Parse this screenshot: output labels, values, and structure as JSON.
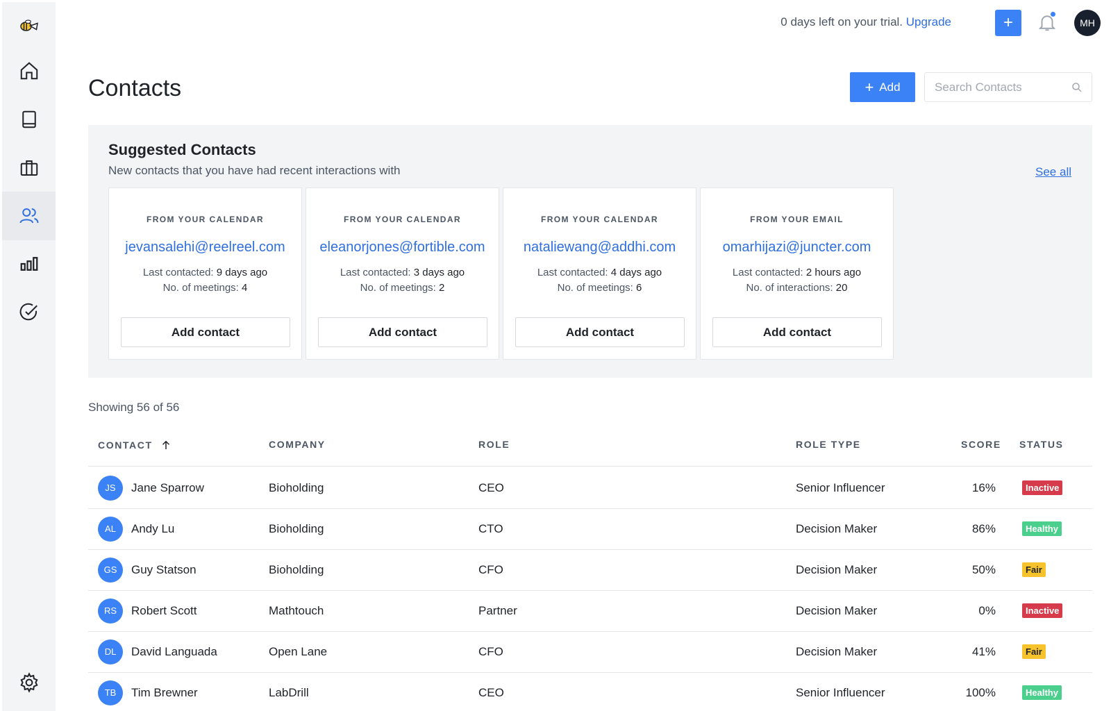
{
  "topbar": {
    "trial_text": "0 days left on your trial.",
    "upgrade_label": "Upgrade",
    "plus_label": "+",
    "avatar_initials": "MH"
  },
  "page": {
    "title": "Contacts",
    "add_label": "Add",
    "search_placeholder": "Search Contacts"
  },
  "suggested": {
    "title": "Suggested Contacts",
    "subtitle": "New contacts that you have had recent interactions with",
    "see_all": "See all",
    "cards": [
      {
        "source": "FROM YOUR CALENDAR",
        "email": "jevansalehi@reelreel.com",
        "contacted_label": "Last contacted:",
        "contacted_value": "9 days ago",
        "count_label": "No. of meetings:",
        "count_value": "4",
        "button": "Add contact"
      },
      {
        "source": "FROM YOUR CALENDAR",
        "email": "eleanorjones@fortible.com",
        "contacted_label": "Last contacted:",
        "contacted_value": "3 days ago",
        "count_label": "No. of meetings:",
        "count_value": "2",
        "button": "Add contact"
      },
      {
        "source": "FROM YOUR CALENDAR",
        "email": "nataliewang@addhi.com",
        "contacted_label": "Last contacted:",
        "contacted_value": "4 days ago",
        "count_label": "No. of meetings:",
        "count_value": "6",
        "button": "Add contact"
      },
      {
        "source": "FROM YOUR EMAIL",
        "email": "omarhijazi@juncter.com",
        "contacted_label": "Last contacted:",
        "contacted_value": "2 hours ago",
        "count_label": "No. of interactions:",
        "count_value": "20",
        "button": "Add contact"
      }
    ]
  },
  "table": {
    "showing": "Showing 56 of 56",
    "headers": {
      "contact": "CONTACT",
      "company": "COMPANY",
      "role": "ROLE",
      "role_type": "ROLE TYPE",
      "score": "SCORE",
      "status": "STATUS"
    },
    "rows": [
      {
        "initials": "JS",
        "name": "Jane Sparrow",
        "company": "Bioholding",
        "role": "CEO",
        "role_type": "Senior Influencer",
        "score": "16%",
        "status": "Inactive"
      },
      {
        "initials": "AL",
        "name": "Andy Lu",
        "company": "Bioholding",
        "role": "CTO",
        "role_type": "Decision Maker",
        "score": "86%",
        "status": "Healthy"
      },
      {
        "initials": "GS",
        "name": "Guy Statson",
        "company": "Bioholding",
        "role": "CFO",
        "role_type": "Decision Maker",
        "score": "50%",
        "status": "Fair"
      },
      {
        "initials": "RS",
        "name": "Robert Scott",
        "company": "Mathtouch",
        "role": "Partner",
        "role_type": "Decision Maker",
        "score": "0%",
        "status": "Inactive"
      },
      {
        "initials": "DL",
        "name": "David Languada",
        "company": "Open Lane",
        "role": "CFO",
        "role_type": "Decision Maker",
        "score": "41%",
        "status": "Fair"
      },
      {
        "initials": "TB",
        "name": "Tim Brewner",
        "company": "LabDrill",
        "role": "CEO",
        "role_type": "Senior Influencer",
        "score": "100%",
        "status": "Healthy"
      }
    ]
  },
  "colors": {
    "accent": "#3b82f6",
    "link": "#2f6fdf",
    "inactive": "#d63b4b",
    "healthy": "#4bcf8c",
    "fair": "#f6c32c"
  },
  "icons": {
    "sidebar": [
      "bee-logo-icon",
      "home-icon",
      "book-icon",
      "briefcase-icon",
      "contacts-icon",
      "bar-chart-icon",
      "check-circle-icon",
      "settings-icon"
    ],
    "topbar": [
      "plus-icon",
      "bell-icon"
    ],
    "search": "search-icon",
    "sort": "arrow-up-icon"
  }
}
